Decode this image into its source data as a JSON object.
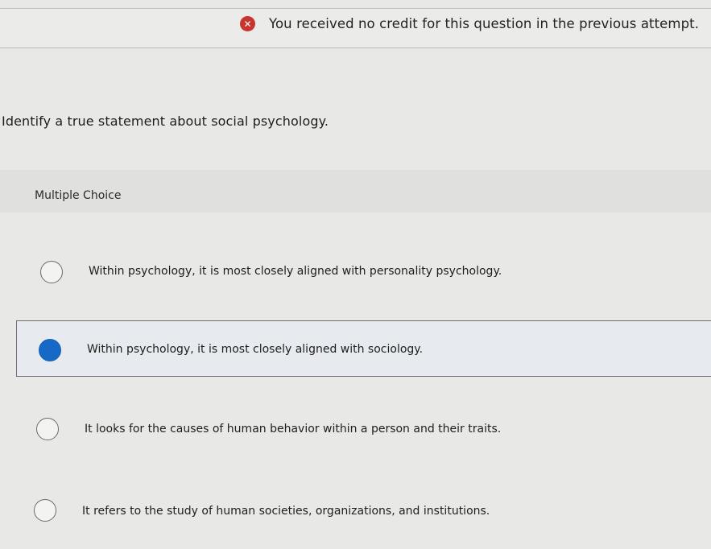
{
  "banner": {
    "icon": "error-x-icon",
    "icon_color": "#c8352e",
    "message": "You received no credit for this question in the previous attempt."
  },
  "question": {
    "prompt": "Identify a true statement about social psychology."
  },
  "multiple_choice": {
    "label": "Multiple Choice",
    "selected_index": 1,
    "accent_color": "#1769c8",
    "options": [
      {
        "text": "Within psychology, it is most closely aligned with personality psychology.",
        "selected": false
      },
      {
        "text": "Within psychology, it is most closely aligned with sociology.",
        "selected": true
      },
      {
        "text": "It looks for the causes of human behavior within a person and their traits.",
        "selected": false
      },
      {
        "text": "It refers to the study of human societies, organizations, and institutions.",
        "selected": false
      }
    ]
  }
}
